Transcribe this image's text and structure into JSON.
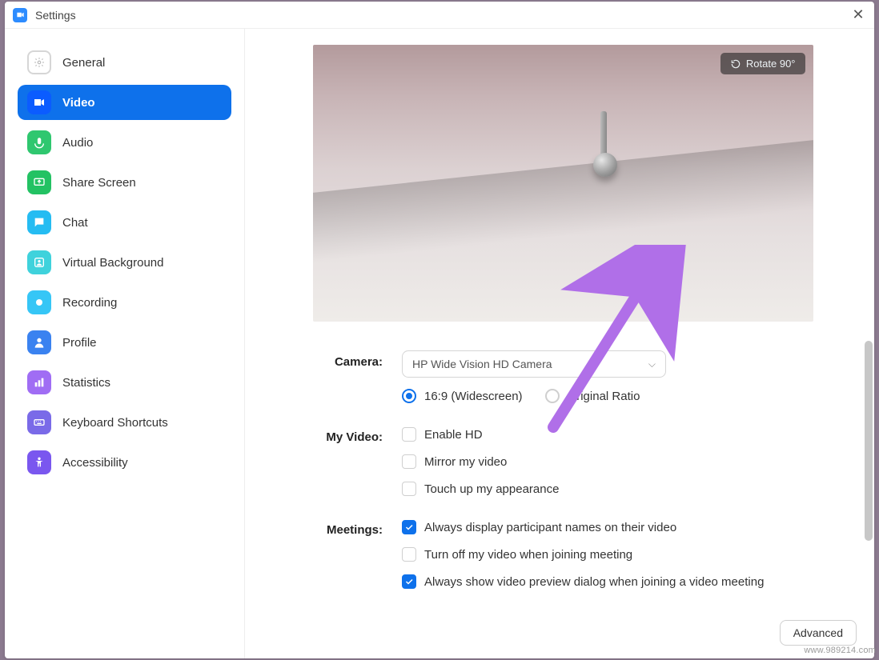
{
  "titlebar": {
    "title": "Settings",
    "close_glyph": "✕"
  },
  "sidebar": {
    "items": [
      {
        "label": "General"
      },
      {
        "label": "Video"
      },
      {
        "label": "Audio"
      },
      {
        "label": "Share Screen"
      },
      {
        "label": "Chat"
      },
      {
        "label": "Virtual Background"
      },
      {
        "label": "Recording"
      },
      {
        "label": "Profile"
      },
      {
        "label": "Statistics"
      },
      {
        "label": "Keyboard Shortcuts"
      },
      {
        "label": "Accessibility"
      }
    ],
    "active_index": 1
  },
  "preview": {
    "rotate_label": "Rotate 90°"
  },
  "form": {
    "camera": {
      "label": "Camera:",
      "selected": "HP Wide Vision HD Camera",
      "ratio_widescreen": "16:9 (Widescreen)",
      "ratio_original": "Original Ratio"
    },
    "my_video": {
      "label": "My Video:",
      "enable_hd": "Enable HD",
      "mirror": "Mirror my video",
      "touchup": "Touch up my appearance"
    },
    "meetings": {
      "label": "Meetings:",
      "show_names": "Always display participant names on their video",
      "turn_off": "Turn off my video when joining meeting",
      "preview_dialog": "Always show video preview dialog when joining a video meeting"
    },
    "advanced": "Advanced"
  },
  "watermark": "www.989214.com"
}
